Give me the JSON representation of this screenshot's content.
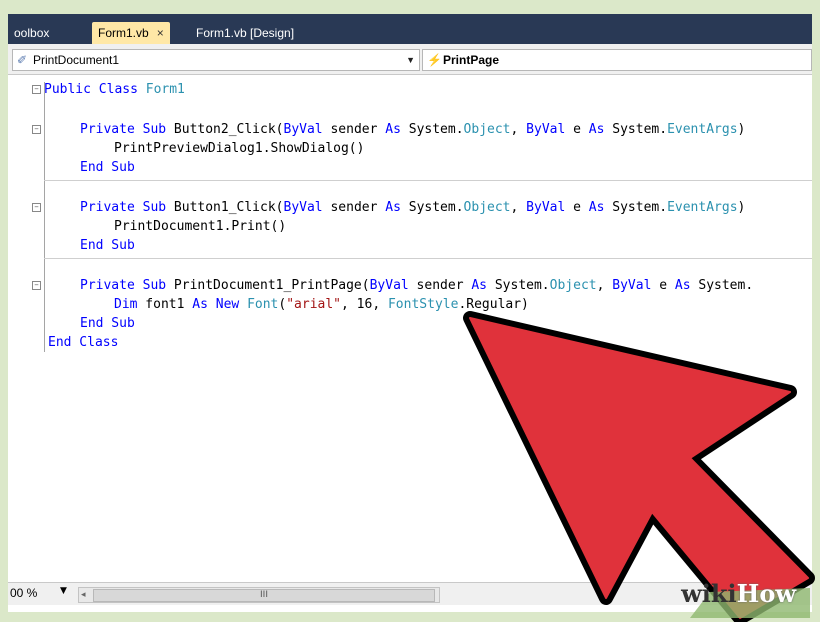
{
  "tabs": [
    {
      "label": "oolbox",
      "active": false
    },
    {
      "label": "Form1.vb",
      "active": true,
      "close": "×"
    },
    {
      "label": "Form1.vb [Design]",
      "active": false
    }
  ],
  "navbar": {
    "left_combo": "PrintDocument1",
    "right_combo": "PrintPage"
  },
  "code": {
    "l1_kw": "Public Class",
    "l1_name": "Form1",
    "l2_a": "Private Sub",
    "l2_b": " Button2_Click(",
    "l2_c": "ByVal",
    "l2_d": " sender ",
    "l2_e": "As",
    "l2_f": " System.",
    "l2_g": "Object",
    "l2_h": ", ",
    "l2_i": "ByVal",
    "l2_j": " e ",
    "l2_k": "As",
    "l2_l": " System.",
    "l2_m": "EventArgs",
    "l2_n": ")",
    "l3": "PrintPreviewDialog1.ShowDialog()",
    "l4": "End Sub",
    "l5_a": "Private Sub",
    "l5_b": " Button1_Click(",
    "l5_c": "ByVal",
    "l5_d": " sender ",
    "l5_e": "As",
    "l5_f": " System.",
    "l5_g": "Object",
    "l5_h": ", ",
    "l5_i": "ByVal",
    "l5_j": " e ",
    "l5_k": "As",
    "l5_l": " System.",
    "l5_m": "EventArgs",
    "l5_n": ")",
    "l6": "PrintDocument1.Print()",
    "l7": "End Sub",
    "l8_a": "Private Sub",
    "l8_b": " PrintDocument1_PrintPage(",
    "l8_c": "ByVal",
    "l8_d": " sender ",
    "l8_e": "As",
    "l8_f": " System.",
    "l8_g": "Object",
    "l8_h": ", ",
    "l8_i": "ByVal",
    "l8_j": " e ",
    "l8_k": "As",
    "l8_l": " System.",
    "l9_a": "Dim",
    "l9_b": " font1 ",
    "l9_c": "As New",
    "l9_d": " ",
    "l9_e": "Font",
    "l9_f": "(",
    "l9_g": "\"arial\"",
    "l9_h": ", 16, ",
    "l9_i": "FontStyle",
    "l9_j": ".Regular)",
    "l10": "End Sub",
    "l11": "End Class"
  },
  "status": {
    "zoom": "00 %",
    "scroll_thumb": "III"
  },
  "watermark": {
    "wiki": "wiki",
    "how": "How"
  },
  "colors": {
    "keyword": "#0000ff",
    "type": "#2b91af",
    "string": "#a31515",
    "arrow": "#e0323b",
    "tab_bar": "#293955",
    "active_tab": "#ffe8a6"
  }
}
